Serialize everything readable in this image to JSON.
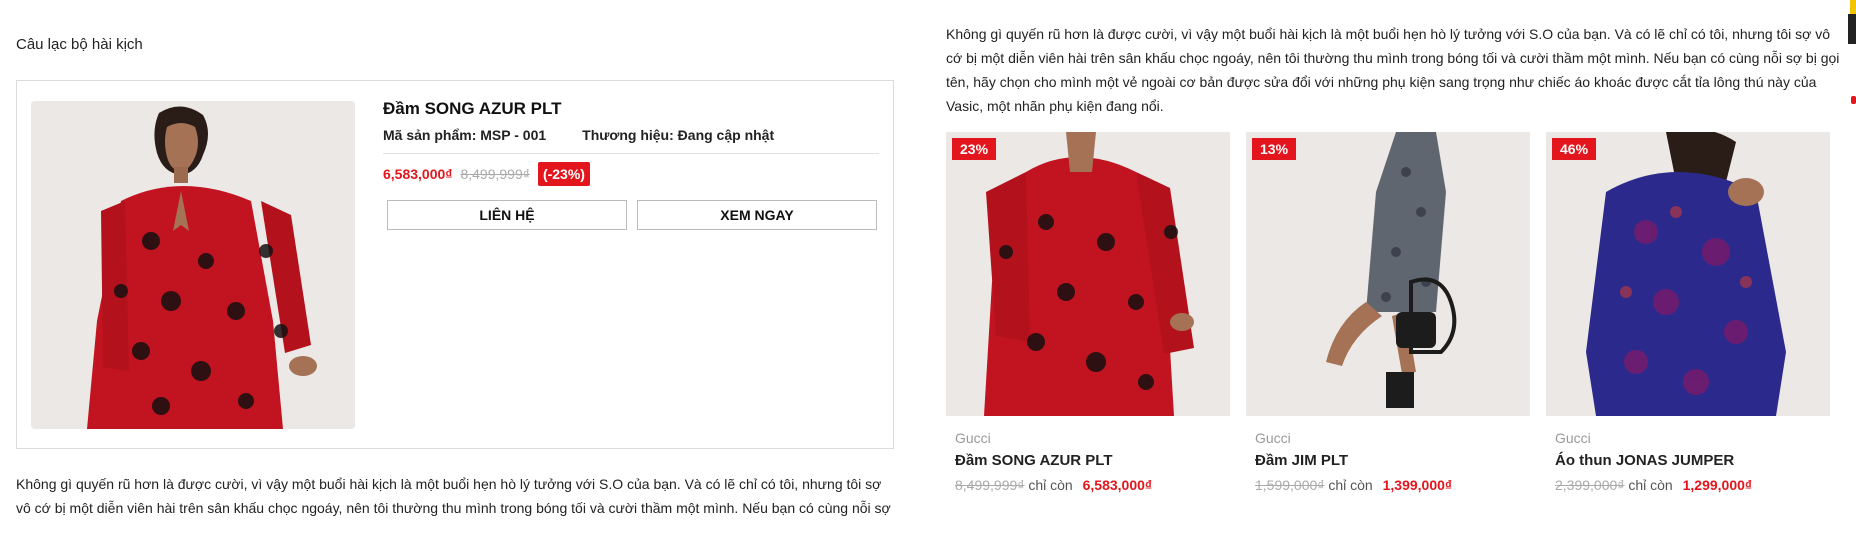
{
  "left": {
    "section_title": "Câu lạc bộ hài kịch",
    "product": {
      "name": "Đầm SONG AZUR PLT",
      "sku_label": "Mã sản phẩm:",
      "sku": "MSP - 001",
      "brand_label": "Thương hiệu:",
      "brand": "Đang cập nhật",
      "price_now": "6,583,000₫",
      "price_old": "8,499,999₫",
      "discount": "(-23%)",
      "contact_label": "LIÊN HỆ",
      "view_label": "XEM NGAY"
    },
    "description": "Không gì quyến rũ hơn là được cười, vì vậy một buổi hài kịch là một buổi hẹn hò lý tưởng với S.O của bạn. Và có lẽ chỉ có tôi, nhưng tôi sợ vô cớ bị một diễn viên hài trên sân khấu chọc ngoáy, nên tôi thường thu mình trong bóng tối và cười thầm một mình. Nếu bạn có cùng nỗi sợ bị gọi tên, hãy chọn cho mình một vẻ ngoài cơ"
  },
  "right": {
    "description": "Không gì quyến rũ hơn là được cười, vì vậy một buổi hài kịch là một buổi hẹn hò lý tưởng với S.O của bạn. Và có lẽ chỉ có tôi, nhưng tôi sợ vô cớ bị một diễn viên hài trên sân khấu chọc ngoáy, nên tôi thường thu mình trong bóng tối và cười thầm một mình. Nếu bạn có cùng nỗi sợ bị gọi tên, hãy chọn cho mình một vẻ ngoài cơ bản được sửa đổi với những phụ kiện sang trọng như chiếc áo khoác được cắt tỉa lông thú này của Vasic, một nhãn phụ kiện đang nổi.",
    "products": [
      {
        "badge": "23%",
        "brand": "Gucci",
        "name": "Đầm SONG AZUR PLT",
        "price_old": "8,499,999₫",
        "remaining": "chỉ còn",
        "price_now": "6,583,000₫"
      },
      {
        "badge": "13%",
        "brand": "Gucci",
        "name": "Đầm JIM PLT",
        "price_old": "1,599,000₫",
        "remaining": "chỉ còn",
        "price_now": "1,399,000₫"
      },
      {
        "badge": "46%",
        "brand": "Gucci",
        "name": "Áo thun JONAS JUMPER",
        "price_old": "2,399,000₫",
        "remaining": "chỉ còn",
        "price_now": "1,299,000₫"
      }
    ]
  },
  "colors": {
    "accent": "#e3161d",
    "muted": "#9a9a9a",
    "border": "#dcdcdc",
    "photo_bg": "#ece8e6"
  }
}
